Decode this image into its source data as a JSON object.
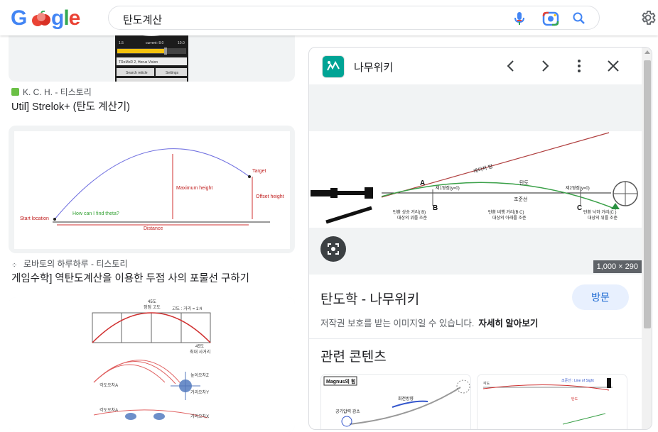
{
  "header": {
    "logo_text": [
      "G",
      "o",
      "o",
      "g",
      "l",
      "e"
    ],
    "search_query": "탄도계산"
  },
  "icons": {
    "mic": "microphone-icon",
    "lens": "camera-lens-icon",
    "search": "search-icon",
    "settings": "gear-icon"
  },
  "results": [
    {
      "source": "K. C. H. - 티스토리",
      "title": "Util] Strelok+ (탄도 계산기)",
      "thumb_texts": [
        "1.5",
        "current: 8.0",
        "10.0",
        "TReMoR 2, Horus Vision",
        "Search reticle",
        "Settings"
      ]
    },
    {
      "source": "로바토의 하루하루 - 티스토리",
      "title": "게임수학] 역탄도계산을 이용한 두점 사의 포물선 구하기",
      "thumb_texts": [
        "Target",
        "Maximum height",
        "Offset height",
        "Start location",
        "How can I find theta?",
        "Distance"
      ]
    },
    {
      "source": "",
      "title": "",
      "thumb_texts": [
        "45도",
        "정점 고도",
        "고도 : 거리 = 1:4",
        "45도",
        "최대 사거리",
        "높이오차Z",
        "각도오차A",
        "거리오차Y",
        "각도오차A",
        "거리오차X"
      ]
    }
  ],
  "panel": {
    "site_name": "나무위키",
    "image_dimensions": "1,000 × 290",
    "image_labels": [
      "레이저 빔",
      "탄도",
      "A",
      "B",
      "C",
      "제1영점(y=0)",
      "제2영점(y=0)",
      "조준선",
      "탄환 상승 거리(  B)",
      "대상의 위를 조준",
      "탄환 비행 거리(B    C)",
      "대상의 아래를 조준",
      "탄환 낙하 거리(C   )",
      "대상의 위를 조준"
    ],
    "result_title": "탄도학 - 나무위키",
    "visit_label": "방문",
    "copyright_text": "저작권 보호를 받는 이미지일 수 있습니다.",
    "learn_more": "자세히 알아보기",
    "related_heading": "관련 콘텐츠",
    "related_thumbs": [
      {
        "texts": [
          "Magnus의 힘",
          "공기압력 감소",
          "회전방향"
        ]
      },
      {
        "texts": [
          "조준선 : Line of Sight",
          "탄도",
          "각도"
        ]
      }
    ]
  },
  "colors": {
    "google_blue": "#4285f4",
    "google_red": "#ea4335",
    "google_yellow": "#fbbc05",
    "google_green": "#34a853",
    "namu_teal": "#00a495",
    "link_blue": "#1967d2"
  }
}
